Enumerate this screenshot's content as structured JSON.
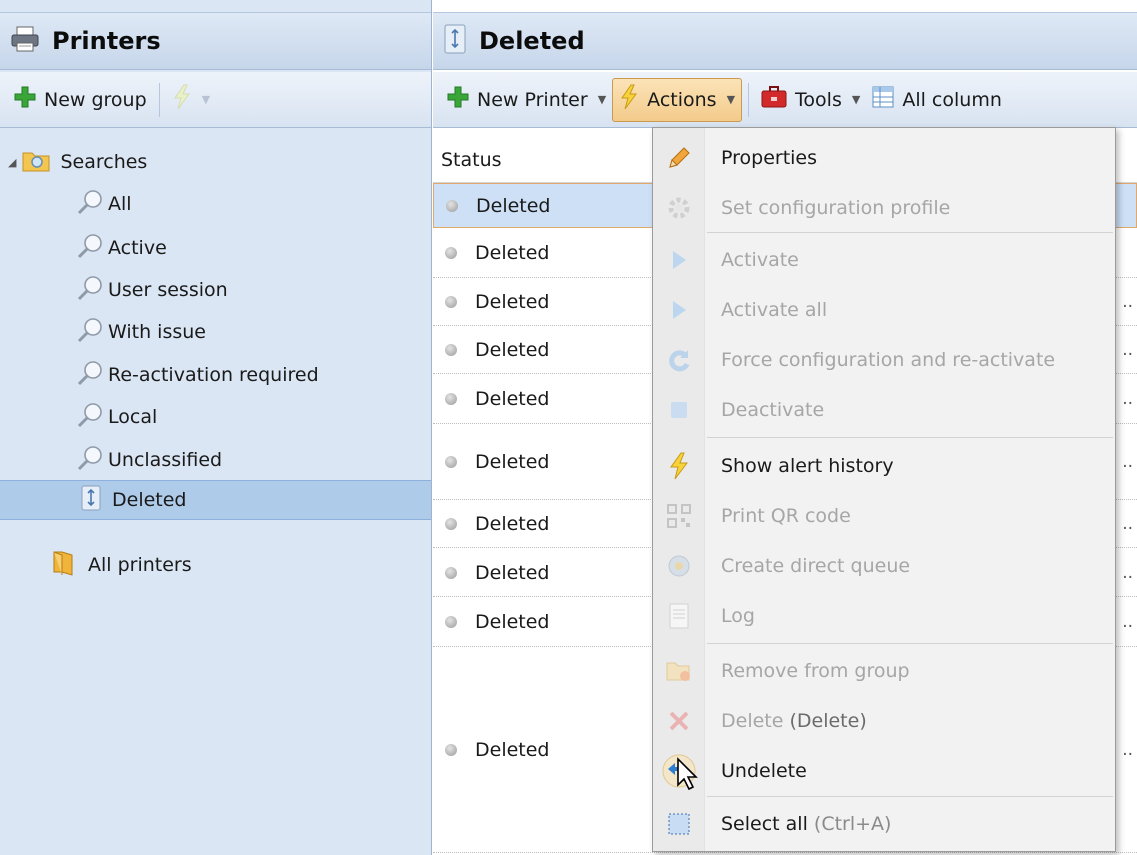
{
  "left": {
    "title": "Printers",
    "toolbar": {
      "new_group_label": "New group"
    },
    "tree": {
      "searches": "Searches",
      "items": [
        {
          "label": "All"
        },
        {
          "label": "Active"
        },
        {
          "label": "User session"
        },
        {
          "label": "With issue"
        },
        {
          "label": "Re-activation required"
        },
        {
          "label": "Local"
        },
        {
          "label": "Unclassified"
        }
      ],
      "deleted": "Deleted",
      "all_printers": "All printers"
    }
  },
  "right": {
    "title": "Deleted",
    "toolbar": {
      "new_printer_label": "New Printer",
      "actions_label": "Actions",
      "tools_label": "Tools",
      "all_columns_label": "All column"
    },
    "columns": {
      "status": "Status"
    },
    "rows": [
      {
        "status": "Deleted"
      },
      {
        "status": "Deleted"
      },
      {
        "status": "Deleted"
      },
      {
        "status": "Deleted"
      },
      {
        "status": "Deleted"
      },
      {
        "status": "Deleted"
      },
      {
        "status": "Deleted"
      },
      {
        "status": "Deleted"
      },
      {
        "status": "Deleted"
      },
      {
        "status": "Deleted"
      }
    ],
    "ellipsis": ".."
  },
  "menu": {
    "properties": "Properties",
    "set_config": "Set configuration profile",
    "activate": "Activate",
    "activate_all": "Activate all",
    "force_config": "Force configuration and re-activate",
    "deactivate": "Deactivate",
    "alert_history": "Show alert history",
    "print_qr": "Print QR code",
    "direct_queue": "Create direct queue",
    "log": "Log",
    "remove_group": "Remove from group",
    "delete": "Delete",
    "delete_shortcut": "(Delete)",
    "undelete": "Undelete",
    "select_all": "Select all",
    "select_all_shortcut": "(Ctrl+A)"
  }
}
